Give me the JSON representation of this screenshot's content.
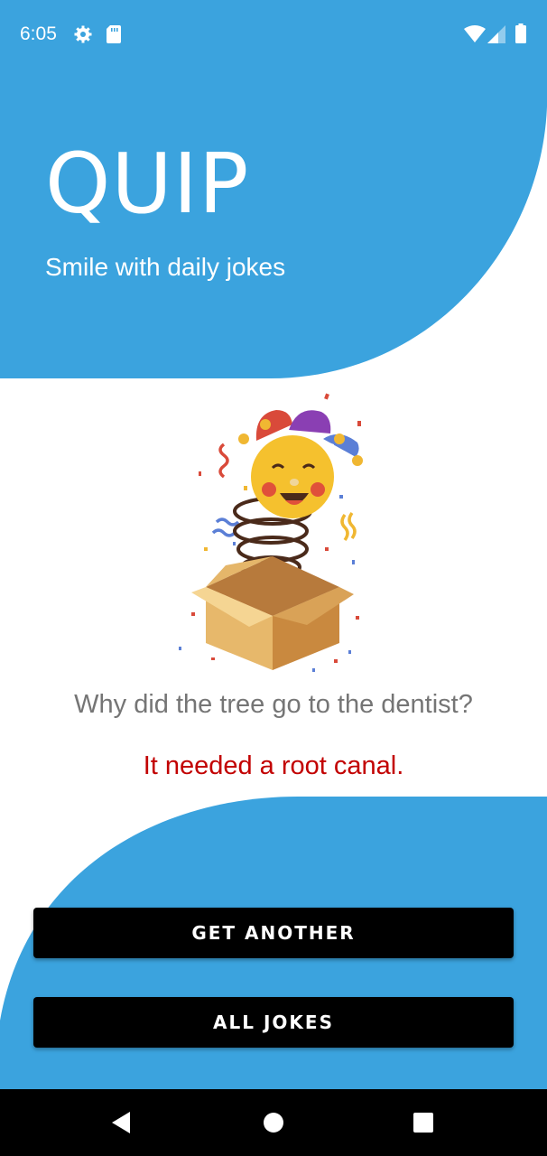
{
  "status_bar": {
    "time": "6:05",
    "icons": [
      "gear-icon",
      "sd-card-icon",
      "wifi-icon",
      "signal-icon",
      "battery-icon"
    ]
  },
  "header": {
    "title": "QUIP",
    "subtitle": "Smile with daily jokes"
  },
  "illustration": {
    "icon": "jester-in-the-box-illustration"
  },
  "joke": {
    "question": "Why did the tree go to the dentist?",
    "answer": "It needed a root canal."
  },
  "actions": {
    "get_another_label": "GET ANOTHER",
    "all_jokes_label": "ALL JOKES"
  },
  "nav_bar": {
    "icons": [
      "back-icon",
      "home-icon",
      "recents-icon"
    ]
  },
  "colors": {
    "brand_blue": "#3BA3DE",
    "answer_red": "#C20000",
    "question_gray": "#757575",
    "button_black": "#000000"
  }
}
